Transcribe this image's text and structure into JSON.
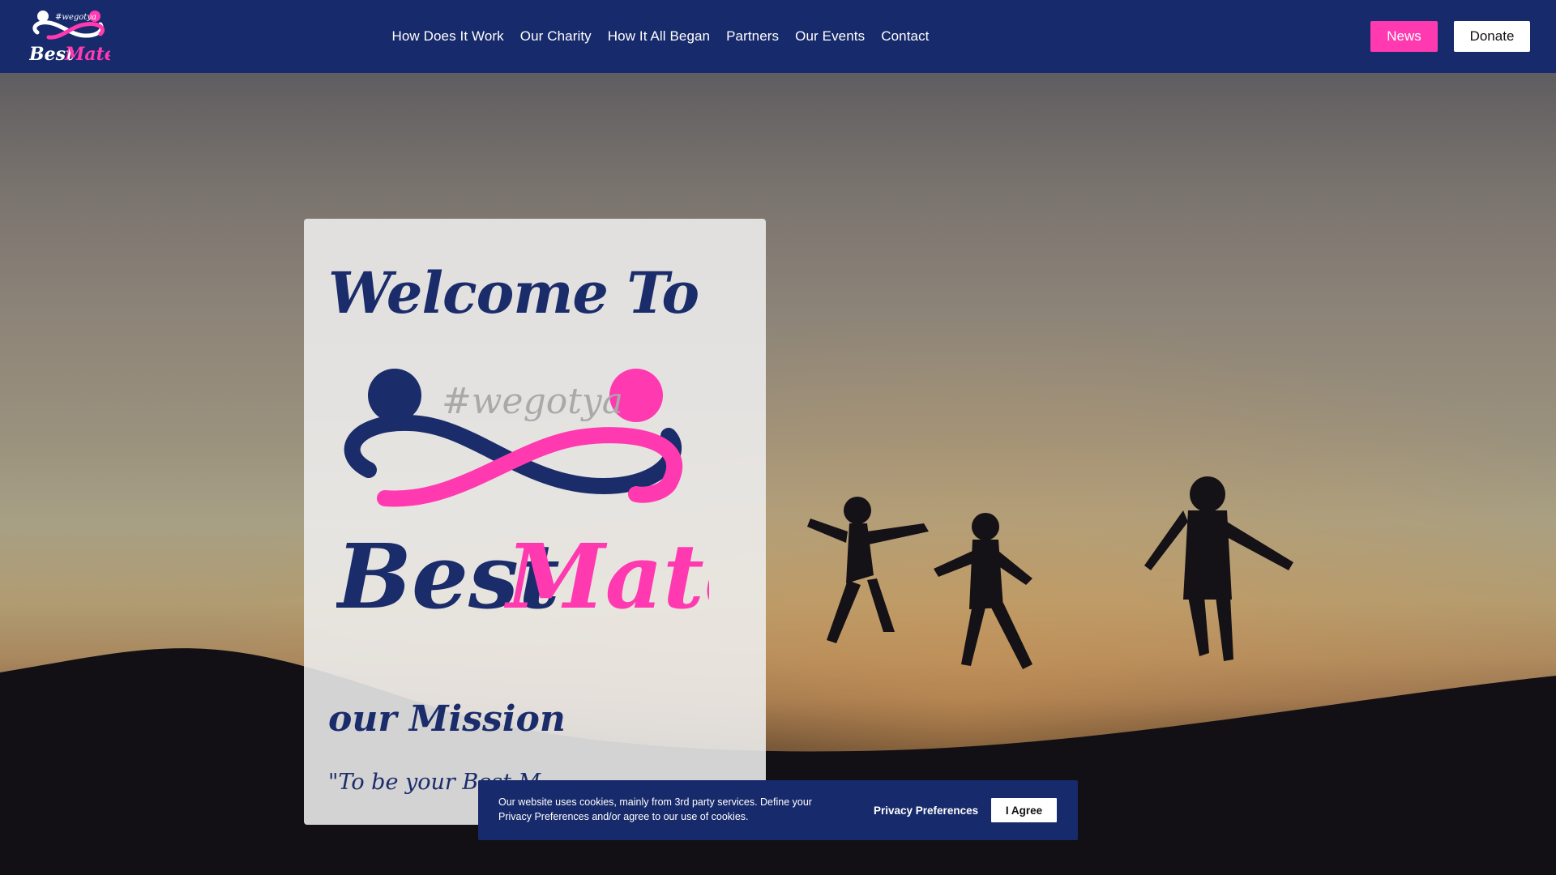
{
  "brand": {
    "hashtag": "#wegotya",
    "name_part1": "Best",
    "name_part2": "Mates",
    "colors": {
      "navy": "#172a6b",
      "pink": "#ff3ab1"
    }
  },
  "nav": {
    "items": [
      {
        "label": "How Does It Work"
      },
      {
        "label": "Our Charity"
      },
      {
        "label": "How It All Began"
      },
      {
        "label": "Partners"
      },
      {
        "label": "Our Events"
      },
      {
        "label": "Contact"
      }
    ],
    "news_label": "News",
    "donate_label": "Donate"
  },
  "hero": {
    "welcome": "Welcome To",
    "mission_title": "our Mission",
    "mission_quote": "\"To be your Best M"
  },
  "cookie": {
    "text": "Our website uses cookies, mainly from 3rd party services. Define your Privacy Preferences and/or agree to our use of cookies.",
    "preferences_label": "Privacy Preferences",
    "agree_label": "I Agree"
  }
}
